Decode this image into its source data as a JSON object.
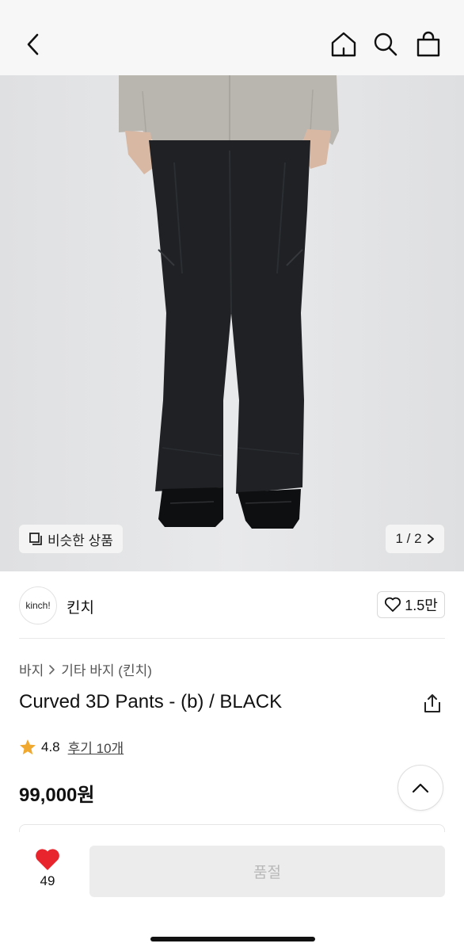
{
  "similar_chip": {
    "label": "비슷한 상품"
  },
  "pagination": {
    "current_label": "1 / 2"
  },
  "brand": {
    "logo_text": "kinch!",
    "name": "킨치",
    "likes_label": "1.5만"
  },
  "breadcrumb": {
    "category": "바지",
    "subcategory": "기타 바지 (킨치)"
  },
  "product": {
    "title": "Curved 3D Pants - (b) / BLACK",
    "rating": "4.8",
    "reviews_label": "후기 10개",
    "price": "99,000원"
  },
  "bottom": {
    "wish_count": "49",
    "soldout_label": "품절"
  },
  "icons": {
    "back": "chevron-left-icon",
    "home": "home-icon",
    "search": "search-icon",
    "bag": "shopping-bag-icon",
    "similar": "copy-squares-icon",
    "next": "chevron-right-icon",
    "heart_outline": "heart-outline-icon",
    "breadcrumb_sep": "chevron-right-icon",
    "share": "share-icon",
    "star": "star-icon",
    "collapse": "chevron-up-icon",
    "heart_filled": "heart-filled-icon"
  },
  "colors": {
    "star": "#f0a82e",
    "heart": "#e8242c",
    "soldout_bg": "#ececec",
    "soldout_text": "#b8b8b8",
    "image_bg": "#e3e4e6"
  }
}
